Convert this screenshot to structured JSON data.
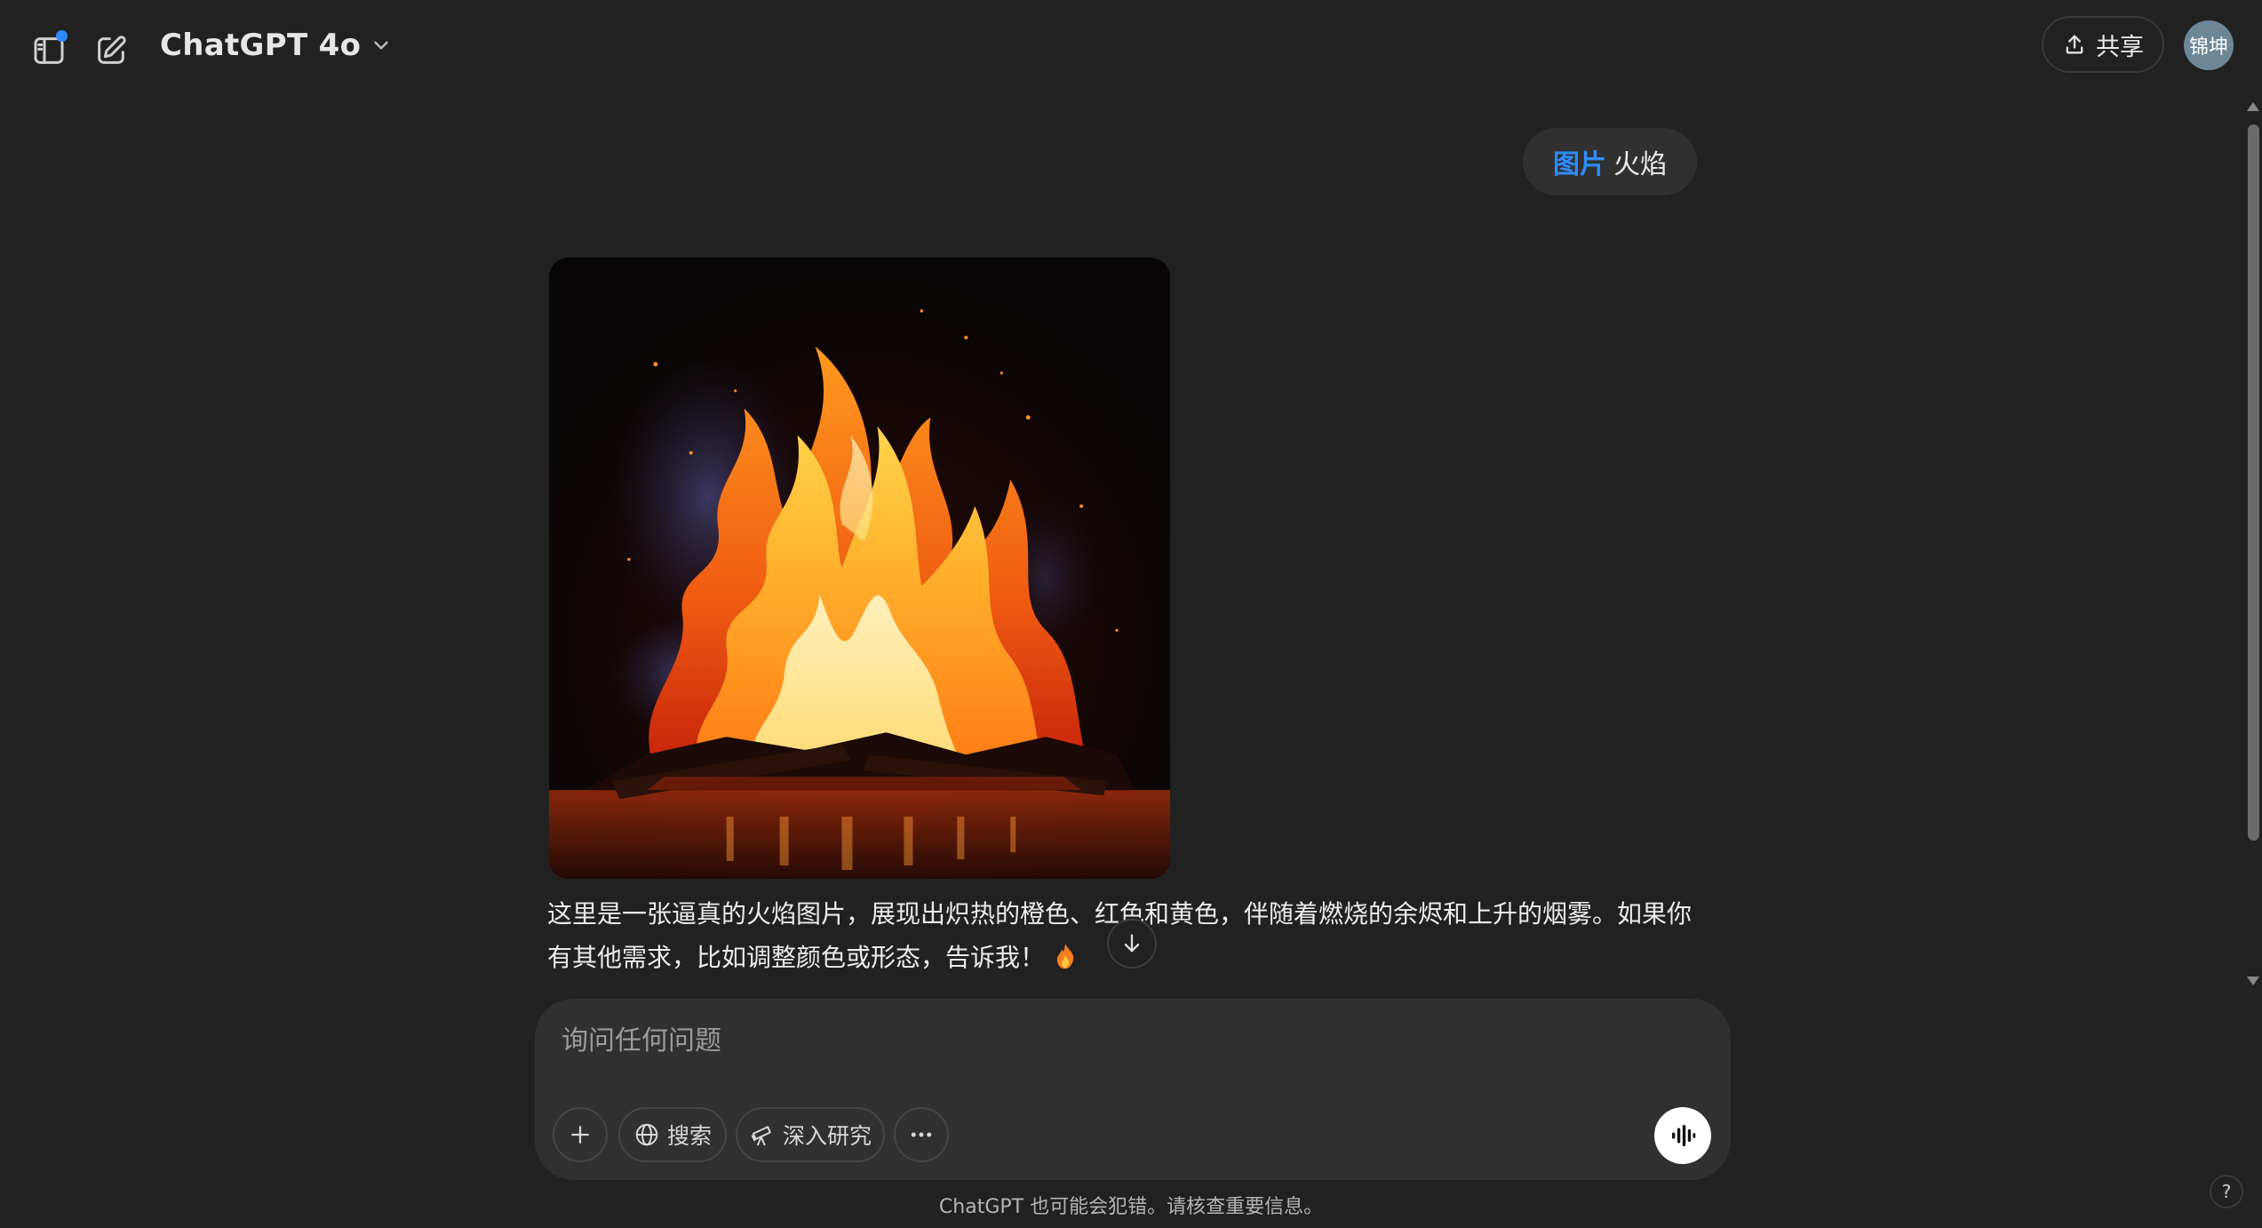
{
  "header": {
    "sidebar_toggle_icon": "sidebar-toggle-icon",
    "new_chat_icon": "new-chat-icon",
    "model_name": "ChatGPT 4o",
    "share_label": "共享",
    "avatar_text": "锦坤"
  },
  "conversation": {
    "user_message": {
      "tag": "图片",
      "text": "火焰"
    },
    "assistant_reply": {
      "text": "这里是一张逼真的火焰图片，展现出炽热的橙色、红色和黄色，伴随着燃烧的余烬和上升的烟雾。如果你有其他需求，比如调整颜色或形态，告诉我！",
      "emoji": "fire-emoji"
    }
  },
  "composer": {
    "placeholder": "询问任何问题",
    "tools": {
      "search": "搜索",
      "deep_research": "深入研究"
    }
  },
  "footer": {
    "disclaimer": "ChatGPT 也可能会犯错。请核查重要信息。",
    "help": "?"
  },
  "colors": {
    "background": "#212121",
    "bubble": "#303030",
    "accent": "#2f8cff",
    "avatar": "#6d8797"
  }
}
